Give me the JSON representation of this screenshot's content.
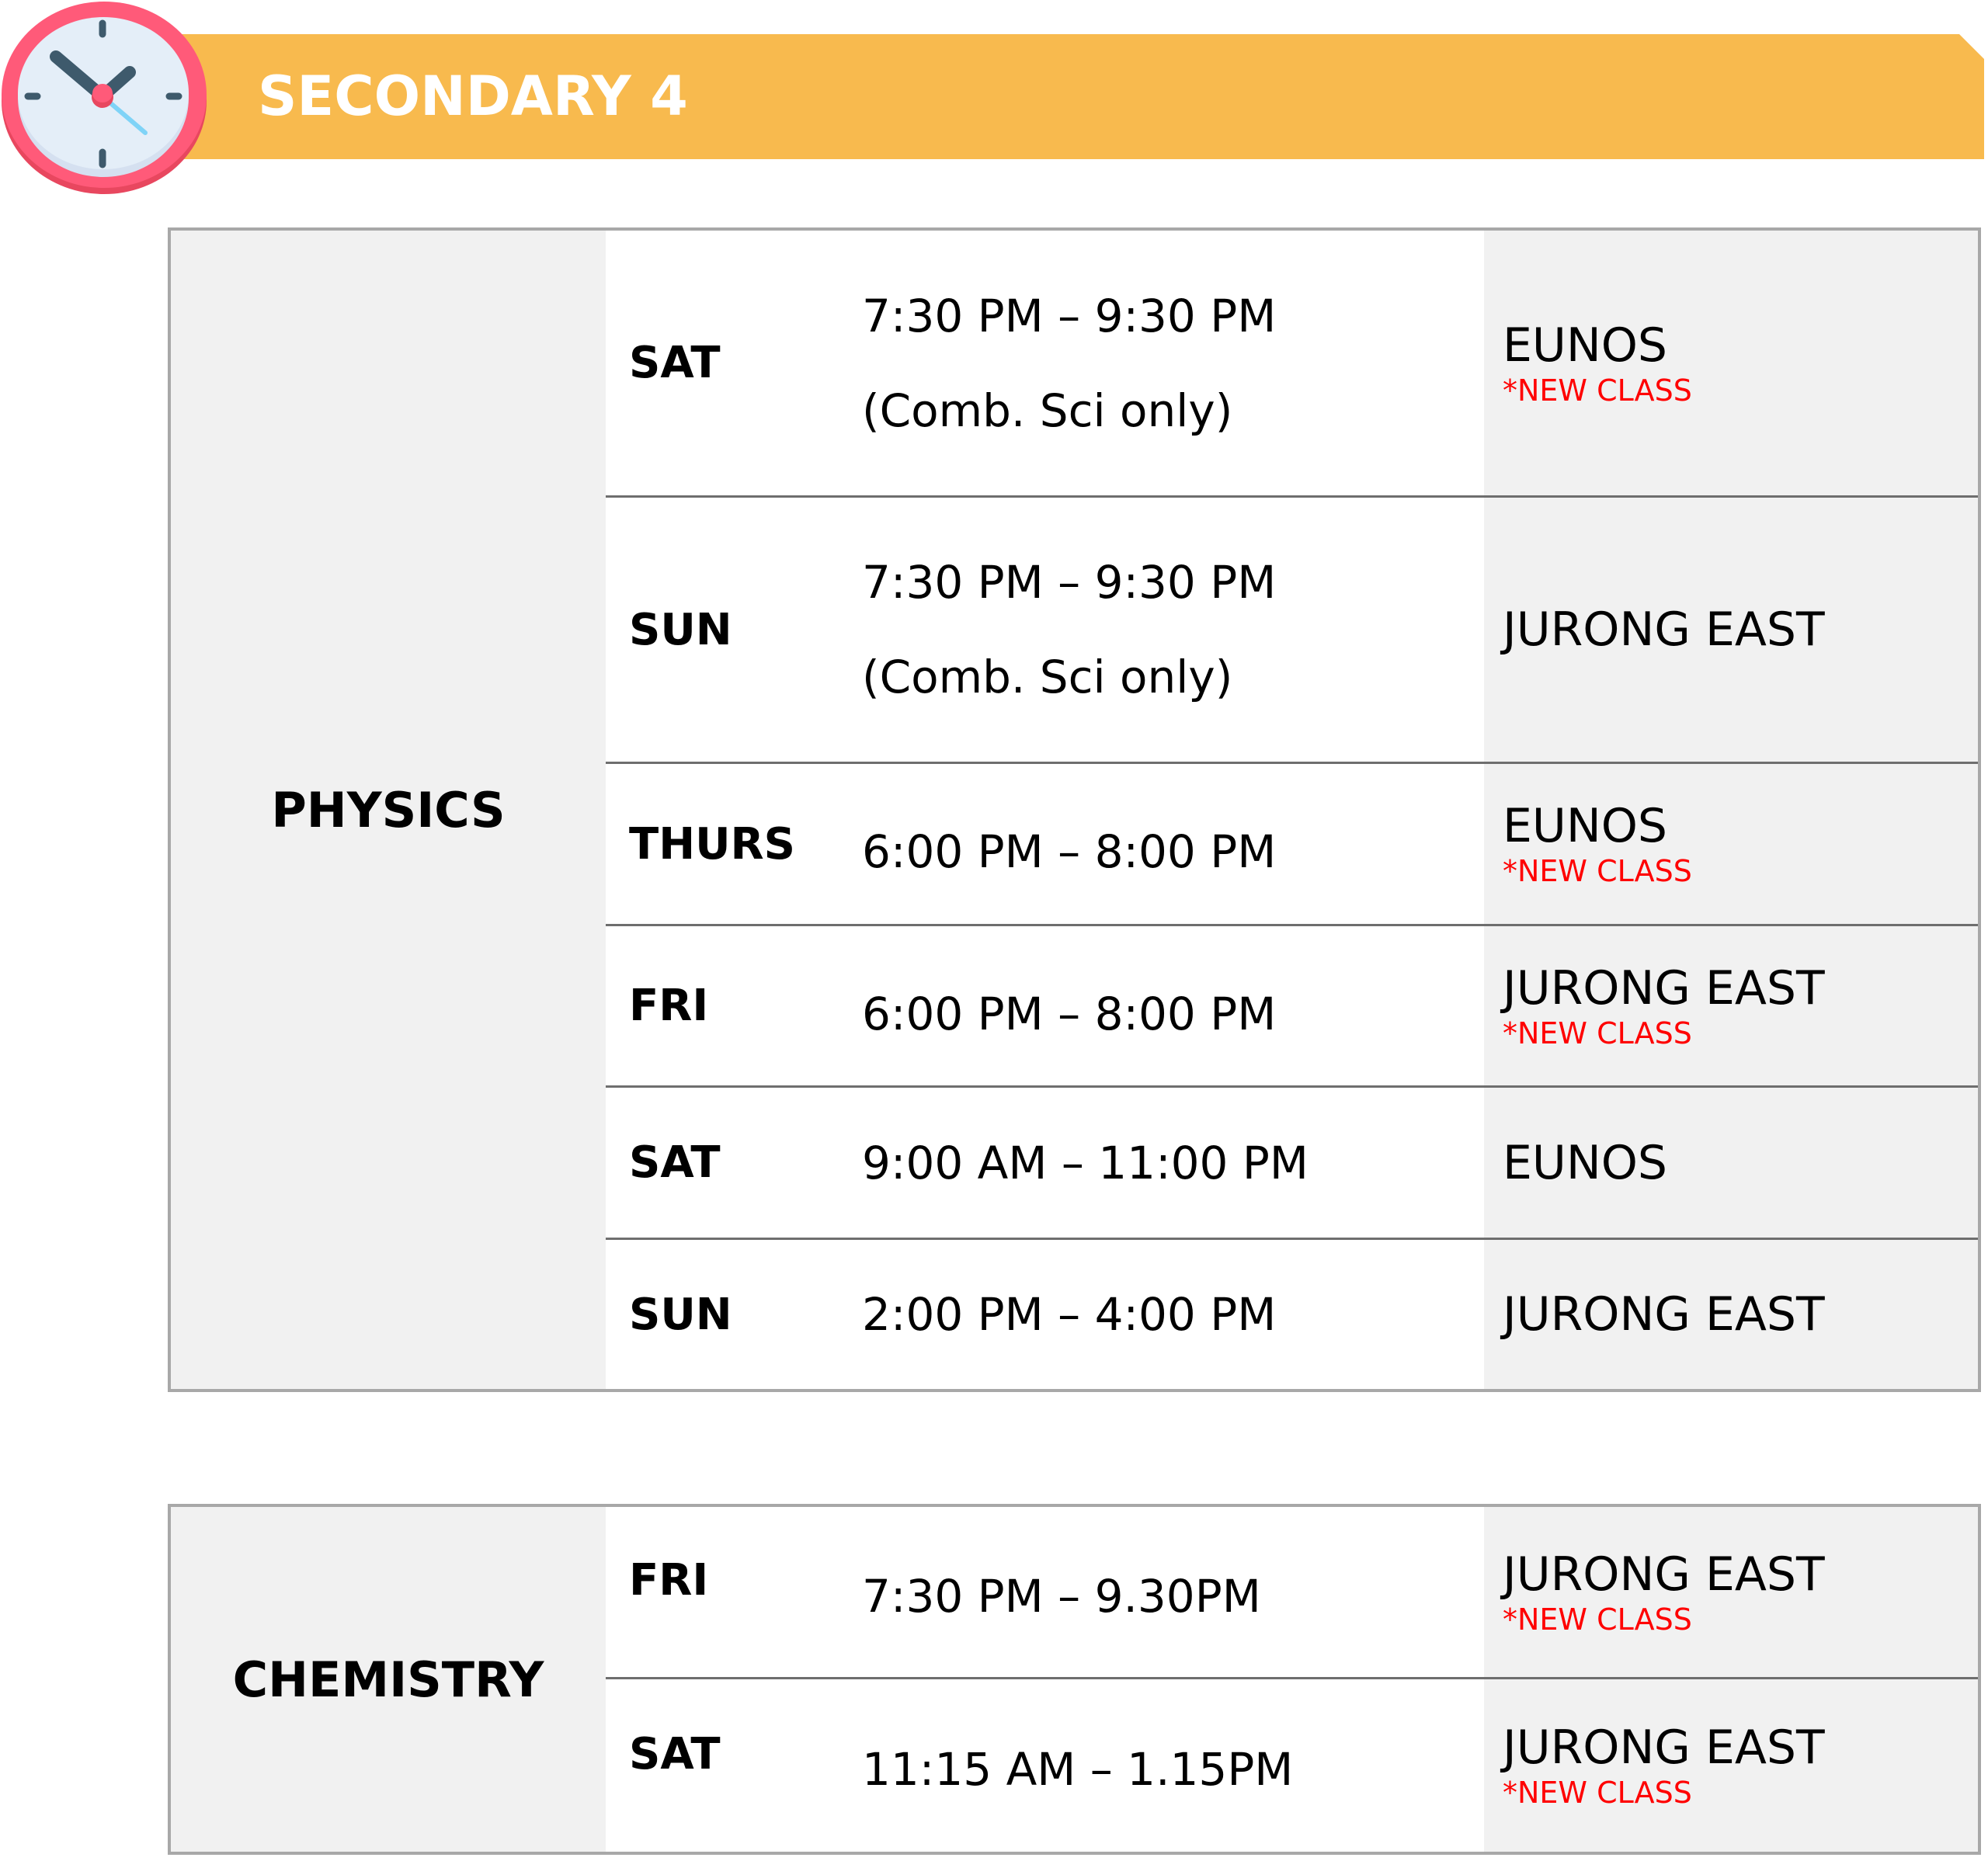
{
  "header": {
    "title": "SECONDARY 4",
    "icon": "clock-icon",
    "colors": {
      "banner": "#F8BA4E",
      "clock_ring": "#FF5A79",
      "clock_face": "#E4EEF8",
      "clock_hands": "#3E5A6C",
      "second_hand": "#7FD3F7",
      "new_class": "#FF0000"
    }
  },
  "tables": [
    {
      "subject": "PHYSICS",
      "rows": [
        {
          "day": "SAT",
          "time": "7:30 PM – 9:30 PM",
          "note": "(Comb. Sci only)",
          "location": "EUNOS",
          "tag": "*NEW CLASS"
        },
        {
          "day": "SUN",
          "time": "7:30 PM – 9:30 PM",
          "note": "(Comb. Sci only)",
          "location": "JURONG EAST",
          "tag": ""
        },
        {
          "day": "THURS",
          "time": "6:00 PM – 8:00 PM",
          "note": "",
          "location": "EUNOS",
          "tag": "*NEW CLASS"
        },
        {
          "day": "FRI",
          "time": "6:00 PM – 8:00 PM",
          "note": "",
          "location": "JURONG EAST",
          "tag": "*NEW CLASS"
        },
        {
          "day": "SAT",
          "time": "9:00 AM – 11:00 PM",
          "note": "",
          "location": "EUNOS",
          "tag": ""
        },
        {
          "day": "SUN",
          "time": "2:00 PM – 4:00 PM",
          "note": "",
          "location": "JURONG EAST",
          "tag": ""
        }
      ]
    },
    {
      "subject": "CHEMISTRY",
      "rows": [
        {
          "day": "FRI",
          "time": "7:30 PM – 9.30PM",
          "note": "",
          "location": "JURONG EAST",
          "tag": "*NEW CLASS"
        },
        {
          "day": "SAT",
          "time": "11:15 AM – 1.15PM",
          "note": "",
          "location": "JURONG EAST",
          "tag": "*NEW CLASS"
        }
      ]
    }
  ]
}
